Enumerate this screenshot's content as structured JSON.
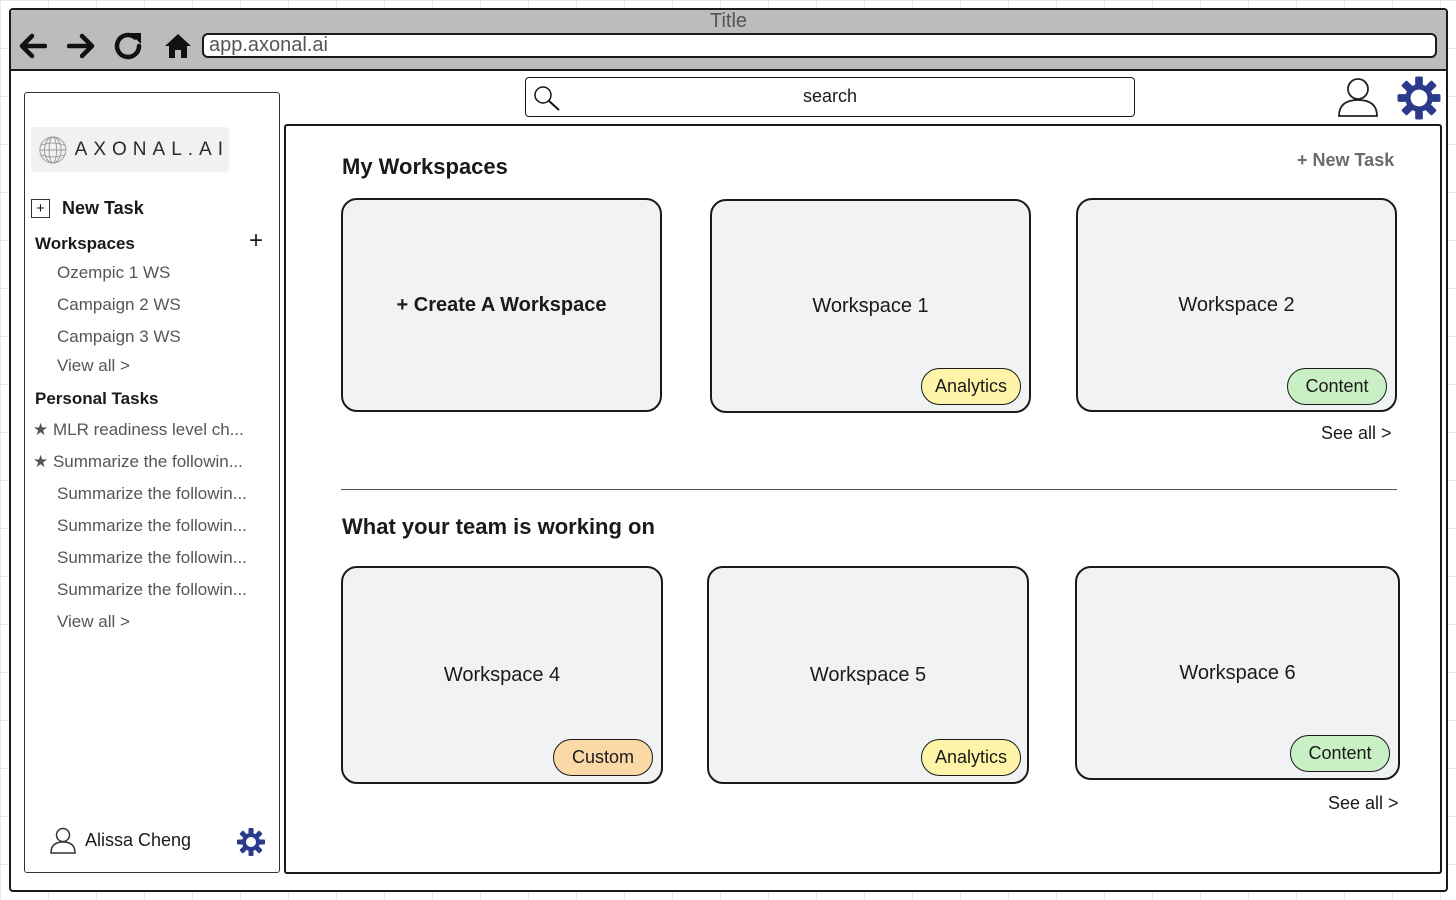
{
  "browser": {
    "title": "Title",
    "url": "app.axonal.ai"
  },
  "sidebar": {
    "logo_text": "AXONAL.AI",
    "new_task_label": "New Task",
    "workspaces_heading": "Workspaces",
    "workspaces": [
      "Ozempic 1 WS",
      "Campaign 2 WS",
      "Campaign 3 WS"
    ],
    "workspaces_view_all": "View all >",
    "personal_tasks_heading": "Personal Tasks",
    "tasks": [
      {
        "label": "★ MLR readiness level ch...",
        "starred": true
      },
      {
        "label": "★ Summarize the followin...",
        "starred": true
      },
      {
        "label": "Summarize the followin...",
        "starred": false
      },
      {
        "label": "Summarize the followin...",
        "starred": false
      },
      {
        "label": "Summarize the followin...",
        "starred": false
      },
      {
        "label": "Summarize the followin...",
        "starred": false
      }
    ],
    "tasks_view_all": "View all >",
    "user_name": "Alissa Cheng"
  },
  "topbar": {
    "search_placeholder": "search"
  },
  "main": {
    "my_workspaces_title": "My Workspaces",
    "new_task_link": "+ New Task",
    "create_card_label": "+ Create A Workspace",
    "my_cards": [
      {
        "name": "Workspace 1",
        "tag": "Analytics",
        "tag_color": "#fff5a8"
      },
      {
        "name": "Workspace 2",
        "tag": "Content",
        "tag_color": "#c9efc4"
      }
    ],
    "see_all_1": "See all >",
    "team_title": "What your team is working on",
    "team_cards": [
      {
        "name": "Workspace 4",
        "tag": "Custom",
        "tag_color": "#fbd9a6"
      },
      {
        "name": "Workspace 5",
        "tag": "Analytics",
        "tag_color": "#fff5a8"
      },
      {
        "name": "Workspace 6",
        "tag": "Content",
        "tag_color": "#c9efc4"
      }
    ],
    "see_all_2": "See all >"
  },
  "colors": {
    "gear": "#2b3a8a",
    "card_bg": "#f1f2f4",
    "chrome_bg": "#bcbcbc"
  }
}
